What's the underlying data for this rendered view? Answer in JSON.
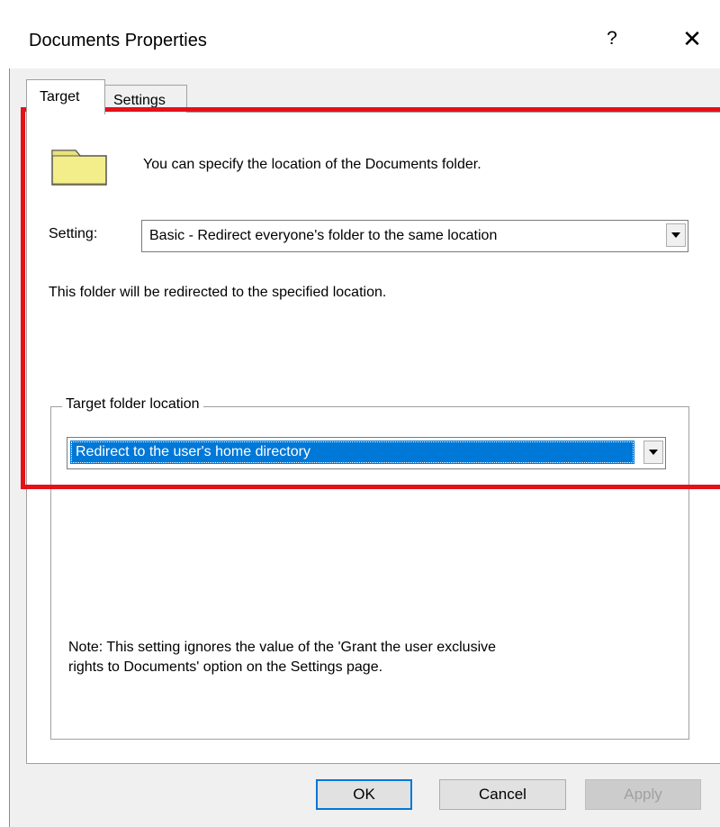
{
  "window": {
    "title": "Documents Properties",
    "help_label": "?",
    "close_label": "✕"
  },
  "tabs": [
    {
      "label": "Target",
      "selected": true
    },
    {
      "label": "Settings",
      "selected": false
    }
  ],
  "target": {
    "intro_text": "You can specify the location of the Documents folder.",
    "folder_icon": "folder-icon",
    "setting_label": "Setting:",
    "setting_value": "Basic - Redirect everyone's folder to the same location",
    "redirect_note": "This folder will be redirected to the specified location.",
    "group_label": "Target folder location",
    "location_value": "Redirect to the user's home directory",
    "note_line1": "Note: This setting ignores the value of the 'Grant the user exclusive",
    "note_line2": "rights to Documents' option on the Settings page."
  },
  "buttons": {
    "ok": "OK",
    "cancel": "Cancel",
    "apply": "Apply"
  },
  "colors": {
    "highlight": "#e4101a",
    "selection": "#0078d7",
    "folder": "#f3ee8a"
  }
}
